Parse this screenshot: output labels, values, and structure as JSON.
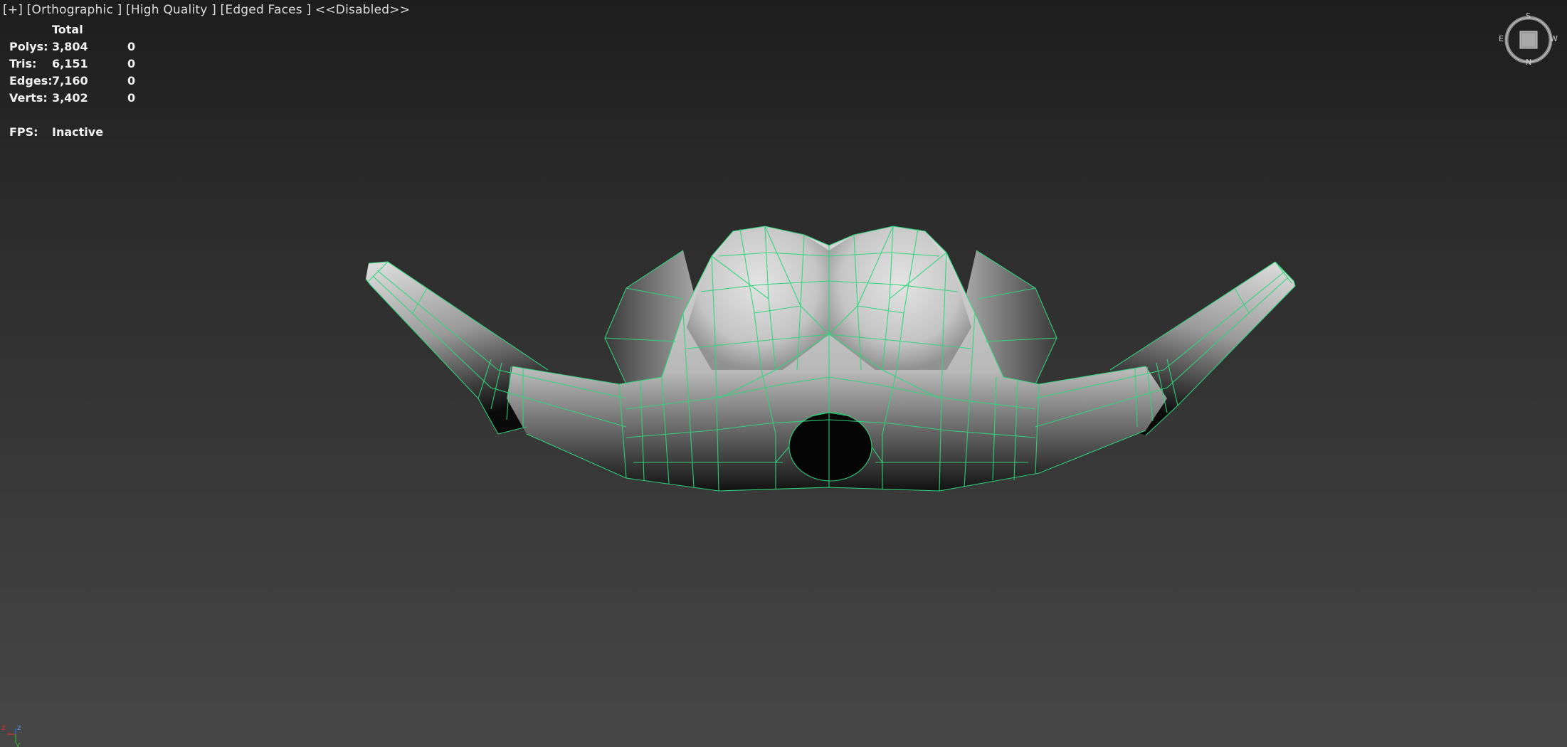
{
  "viewport": {
    "menu_plus": "[+]",
    "view_mode": "[Orthographic ]",
    "quality": "[High Quality ]",
    "edged_faces": "[Edged Faces ]",
    "disabled": "<<Disabled>>"
  },
  "stats": {
    "header": "Total",
    "rows": [
      {
        "label": "Polys:",
        "total": "3,804",
        "selected": "0"
      },
      {
        "label": "Tris:",
        "total": "6,151",
        "selected": "0"
      },
      {
        "label": "Edges:",
        "total": "7,160",
        "selected": "0"
      },
      {
        "label": "Verts:",
        "total": "3,402",
        "selected": "0"
      }
    ],
    "fps_label": "FPS:",
    "fps_value": "Inactive"
  },
  "viewcube": {
    "top": "S",
    "bottom": "N",
    "left": "E",
    "right": "W"
  },
  "axis": {
    "x": "x",
    "y": "y",
    "z": "z",
    "x_color": "#d03030",
    "y_color": "#30a030",
    "z_color": "#3060d0"
  },
  "colors": {
    "wire": "#2fd67a"
  }
}
